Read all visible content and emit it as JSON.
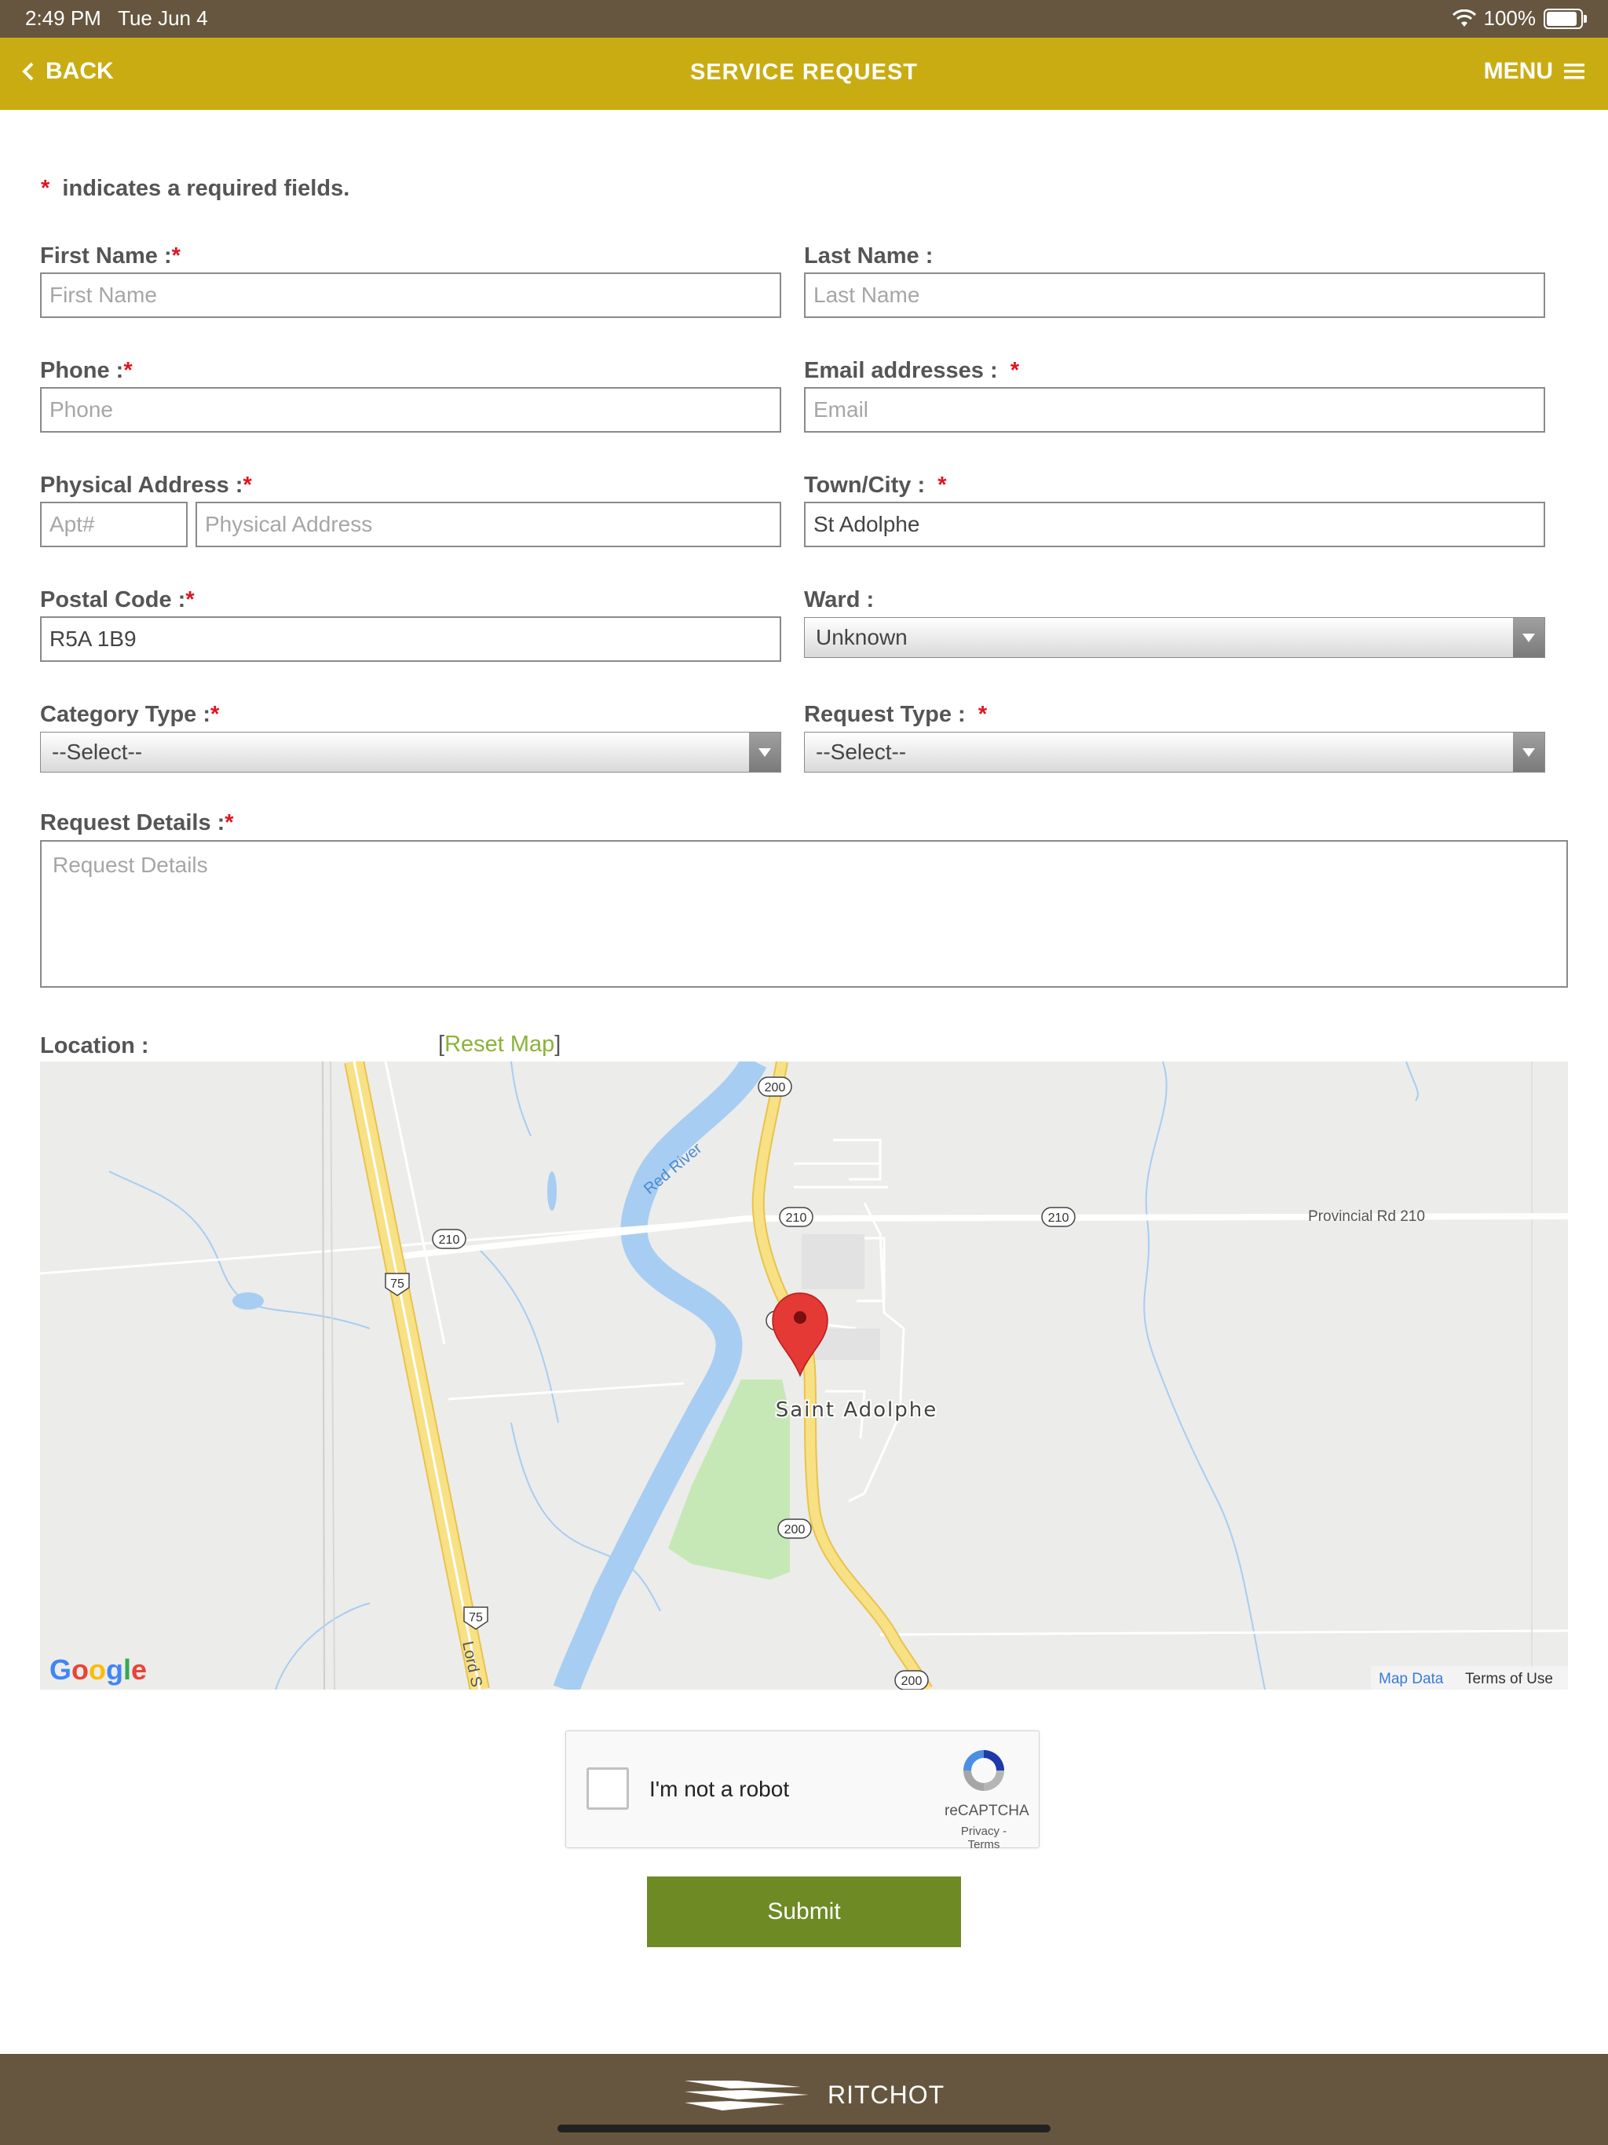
{
  "status": {
    "time": "2:49 PM",
    "date": "Tue Jun 4",
    "battery": "100%",
    "battery_level": 1.0
  },
  "header": {
    "back_label": "BACK",
    "title": "SERVICE REQUEST",
    "menu_label": "MENU"
  },
  "form": {
    "required_note": "indicates a required fields.",
    "required_mark": "*",
    "first_name": {
      "label": "First Name :",
      "placeholder": "First Name",
      "value": ""
    },
    "last_name": {
      "label": "Last Name :",
      "placeholder": "Last Name",
      "value": ""
    },
    "phone": {
      "label": "Phone :",
      "placeholder": "Phone",
      "value": ""
    },
    "email": {
      "label": "Email addresses :",
      "placeholder": "Email",
      "value": ""
    },
    "address": {
      "label": "Physical Address :",
      "apt_placeholder": "Apt#",
      "placeholder": "Physical Address",
      "value": ""
    },
    "town": {
      "label": "Town/City :",
      "value": "St Adolphe"
    },
    "postal": {
      "label": "Postal Code :",
      "value": "R5A 1B9"
    },
    "ward": {
      "label": "Ward :",
      "selected": "Unknown"
    },
    "category": {
      "label": "Category Type :",
      "selected": "--Select--"
    },
    "request_type": {
      "label": "Request Type :",
      "selected": "--Select--"
    },
    "details": {
      "label": "Request Details :",
      "placeholder": "Request Details"
    },
    "location": {
      "label": "Location :",
      "reset_open": "[",
      "reset_label": "Reset Map",
      "reset_close": "]"
    }
  },
  "map": {
    "town_label": "Saint Adolphe",
    "river_label": "Red River",
    "road_label": "Provincial Rd 210",
    "lord_label": "Lord S",
    "shields": {
      "r200": "200",
      "r210": "210",
      "r75": "75",
      "r20": "20"
    },
    "map_data": "Map Data",
    "terms": "Terms of Use",
    "google": [
      "G",
      "o",
      "o",
      "g",
      "l",
      "e"
    ],
    "colors": {
      "water": "#a7cdf2",
      "park": "#c6e8b6",
      "highway": "#f8e184",
      "highway_edge": "#e8c34d",
      "land": "#ececea"
    }
  },
  "captcha": {
    "text": "I'm not a robot",
    "brand": "reCAPTCHA",
    "privacy": "Privacy - Terms"
  },
  "submit_label": "Submit",
  "footer": {
    "brand": "RITCHOT"
  },
  "colors": {
    "header": "#c9ac12",
    "status": "#66563f",
    "submit": "#6d8a24",
    "required": "#e0141e",
    "link": "#8ab337"
  }
}
